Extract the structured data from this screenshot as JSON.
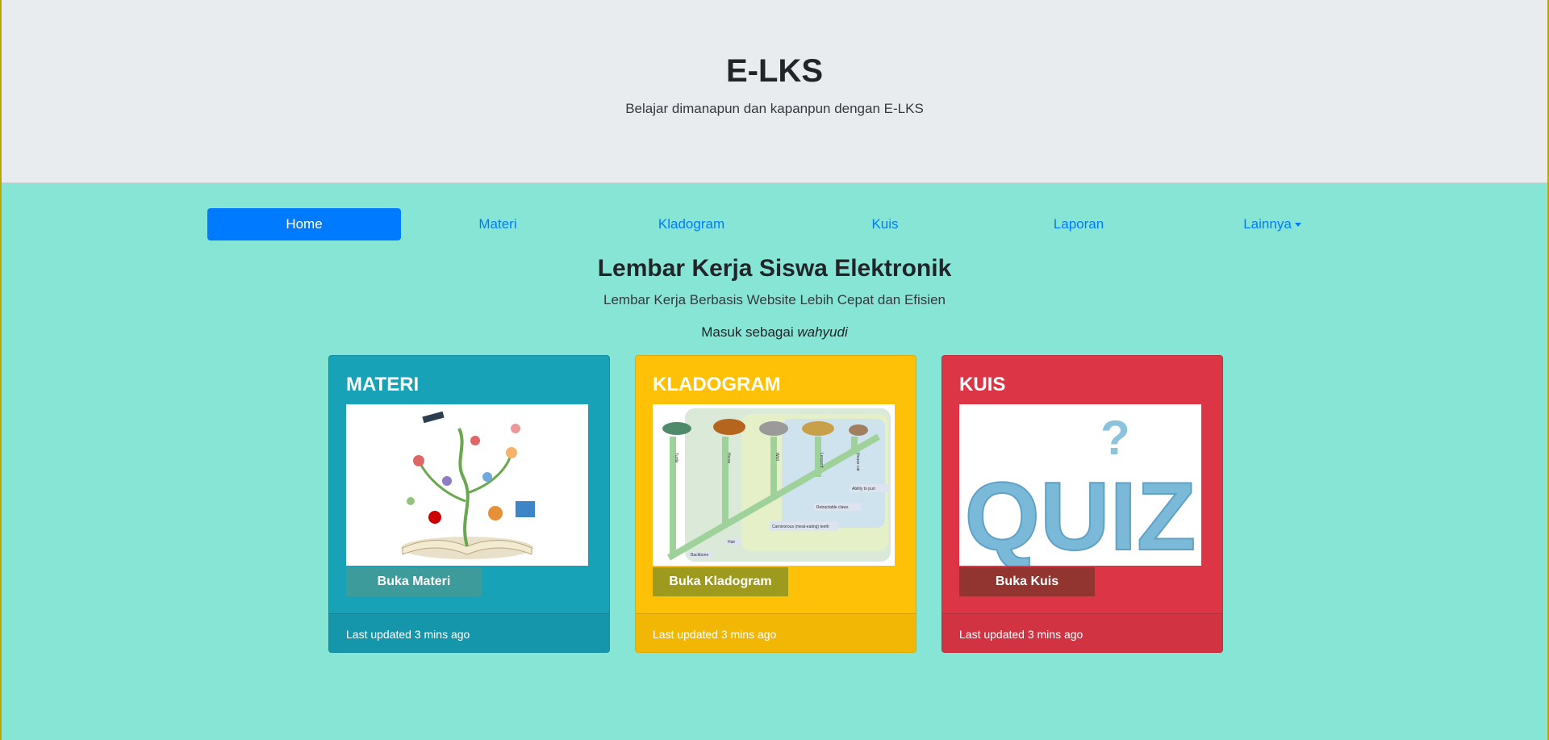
{
  "header": {
    "brand": "E-LKS",
    "tagline": "Belajar dimanapun dan kapanpun dengan E-LKS"
  },
  "nav": {
    "items": [
      {
        "label": "Home",
        "active": true
      },
      {
        "label": "Materi"
      },
      {
        "label": "Kladogram"
      },
      {
        "label": "Kuis"
      },
      {
        "label": "Laporan"
      },
      {
        "label": "Lainnya"
      }
    ]
  },
  "main": {
    "title": "Lembar Kerja Siswa Elektronik",
    "subtitle": "Lembar Kerja Berbasis Website Lebih Cepat dan Efisien",
    "login_prefix": "Masuk sebagai",
    "login_user": "wahyudi"
  },
  "cards": [
    {
      "title": "MATERI",
      "button": "Buka Materi",
      "footer": "Last updated 3 mins ago",
      "image": "book-tree-illustration",
      "color": "#17a2b8"
    },
    {
      "title": "KLADOGRAM",
      "button": "Buka Kladogram",
      "footer": "Last updated 3 mins ago",
      "image": "cladogram-diagram",
      "color": "#ffc107",
      "image_labels": {
        "animals": [
          "Turtle",
          "Horse",
          "Wolf",
          "Leopard",
          "House cat"
        ],
        "traits": [
          "Ability to purr",
          "Retractable claws",
          "Carnivorous (meat-eating) teeth",
          "Hair",
          "Backbone"
        ]
      }
    },
    {
      "title": "KUIS",
      "button": "Buka Kuis",
      "footer": "Last updated 3 mins ago",
      "image": "quiz-lettering",
      "color": "#dc3545",
      "image_text": "QUIZ"
    }
  ]
}
